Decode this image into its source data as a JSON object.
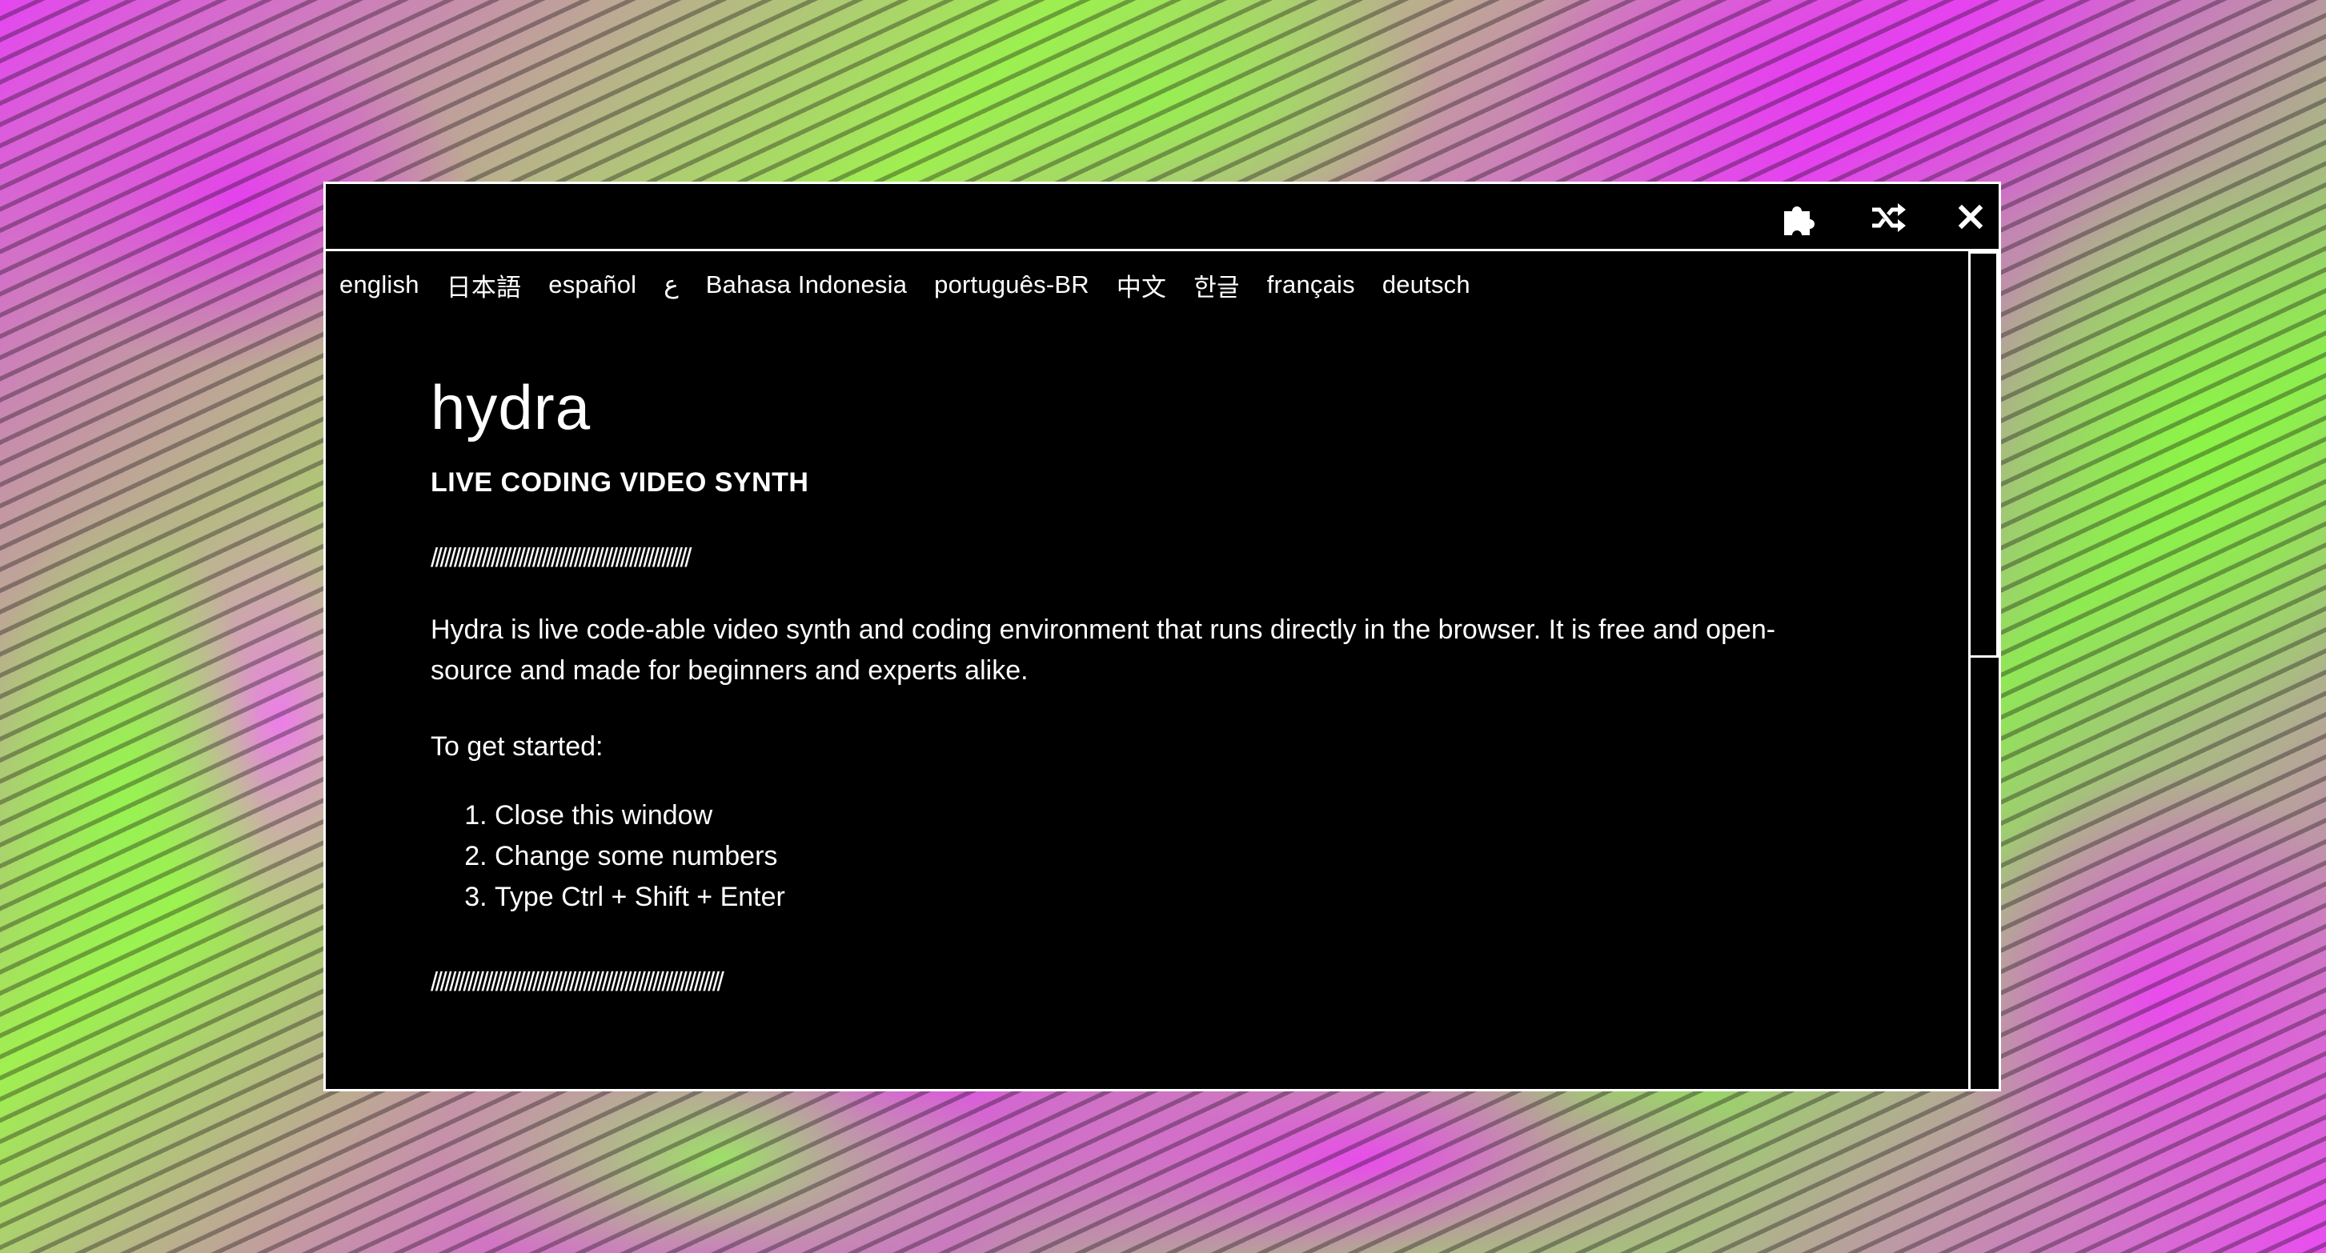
{
  "toolbar": {
    "plugins_icon": "puzzle-piece-icon",
    "shuffle_icon": "shuffle-icon",
    "close_icon": "close-icon"
  },
  "languages": [
    "english",
    "日本語",
    "español",
    "ع",
    "Bahasa Indonesia",
    "português-BR",
    "中文",
    "한글",
    "français",
    "deutsch"
  ],
  "info": {
    "title": "hydra",
    "subtitle": "LIVE CODING VIDEO SYNTH",
    "divider_1": "////////////////////////////////////////////////////////",
    "intro": "Hydra is live code-able video synth and coding environment that runs directly in the browser. It is free and open-source and made for beginners and experts alike.",
    "get_started": "To get started:",
    "steps": [
      "Close this window",
      "Change some numbers",
      "Type Ctrl + Shift + Enter"
    ],
    "divider_2": "///////////////////////////////////////////////////////////////"
  },
  "colors": {
    "window_bg": "#000000",
    "window_border": "#ffffff",
    "text": "#ffffff",
    "bg_magenta": "#e446f0",
    "bg_green": "#9ff050"
  }
}
